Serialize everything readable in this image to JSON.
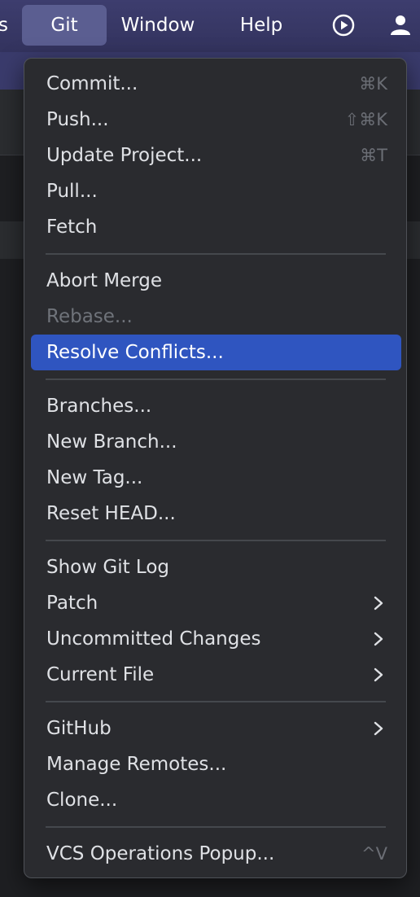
{
  "menubar": {
    "items": [
      "s",
      "Git",
      "Window",
      "Help"
    ],
    "icons": [
      "run-icon",
      "account-icon"
    ]
  },
  "menu": {
    "groups": [
      [
        {
          "label": "Commit...",
          "shortcut": "⌘K"
        },
        {
          "label": "Push...",
          "shortcut": "⇧⌘K"
        },
        {
          "label": "Update Project...",
          "shortcut": "⌘T"
        },
        {
          "label": "Pull...",
          "shortcut": ""
        },
        {
          "label": "Fetch",
          "shortcut": ""
        }
      ],
      [
        {
          "label": "Abort Merge",
          "shortcut": ""
        },
        {
          "label": "Rebase...",
          "shortcut": "",
          "disabled": true
        },
        {
          "label": "Resolve Conflicts...",
          "shortcut": "",
          "highlighted": true
        }
      ],
      [
        {
          "label": "Branches...",
          "shortcut": ""
        },
        {
          "label": "New Branch...",
          "shortcut": ""
        },
        {
          "label": "New Tag...",
          "shortcut": ""
        },
        {
          "label": "Reset HEAD...",
          "shortcut": ""
        }
      ],
      [
        {
          "label": "Show Git Log",
          "shortcut": ""
        },
        {
          "label": "Patch",
          "submenu": true
        },
        {
          "label": "Uncommitted Changes",
          "submenu": true
        },
        {
          "label": "Current File",
          "submenu": true
        }
      ],
      [
        {
          "label": "GitHub",
          "submenu": true
        },
        {
          "label": "Manage Remotes...",
          "shortcut": ""
        },
        {
          "label": "Clone...",
          "shortcut": ""
        }
      ],
      [
        {
          "label": "VCS Operations Popup...",
          "shortcut": "^V"
        }
      ]
    ]
  },
  "colors": {
    "menubar": "#3a3a68",
    "menubar_active": "#5b5e91",
    "menu_bg": "#2a2b2f",
    "highlight": "#2f55c0",
    "text": "#dfe1e5",
    "disabled_text": "#6f737a",
    "shortcut_text": "#6b6e75"
  }
}
